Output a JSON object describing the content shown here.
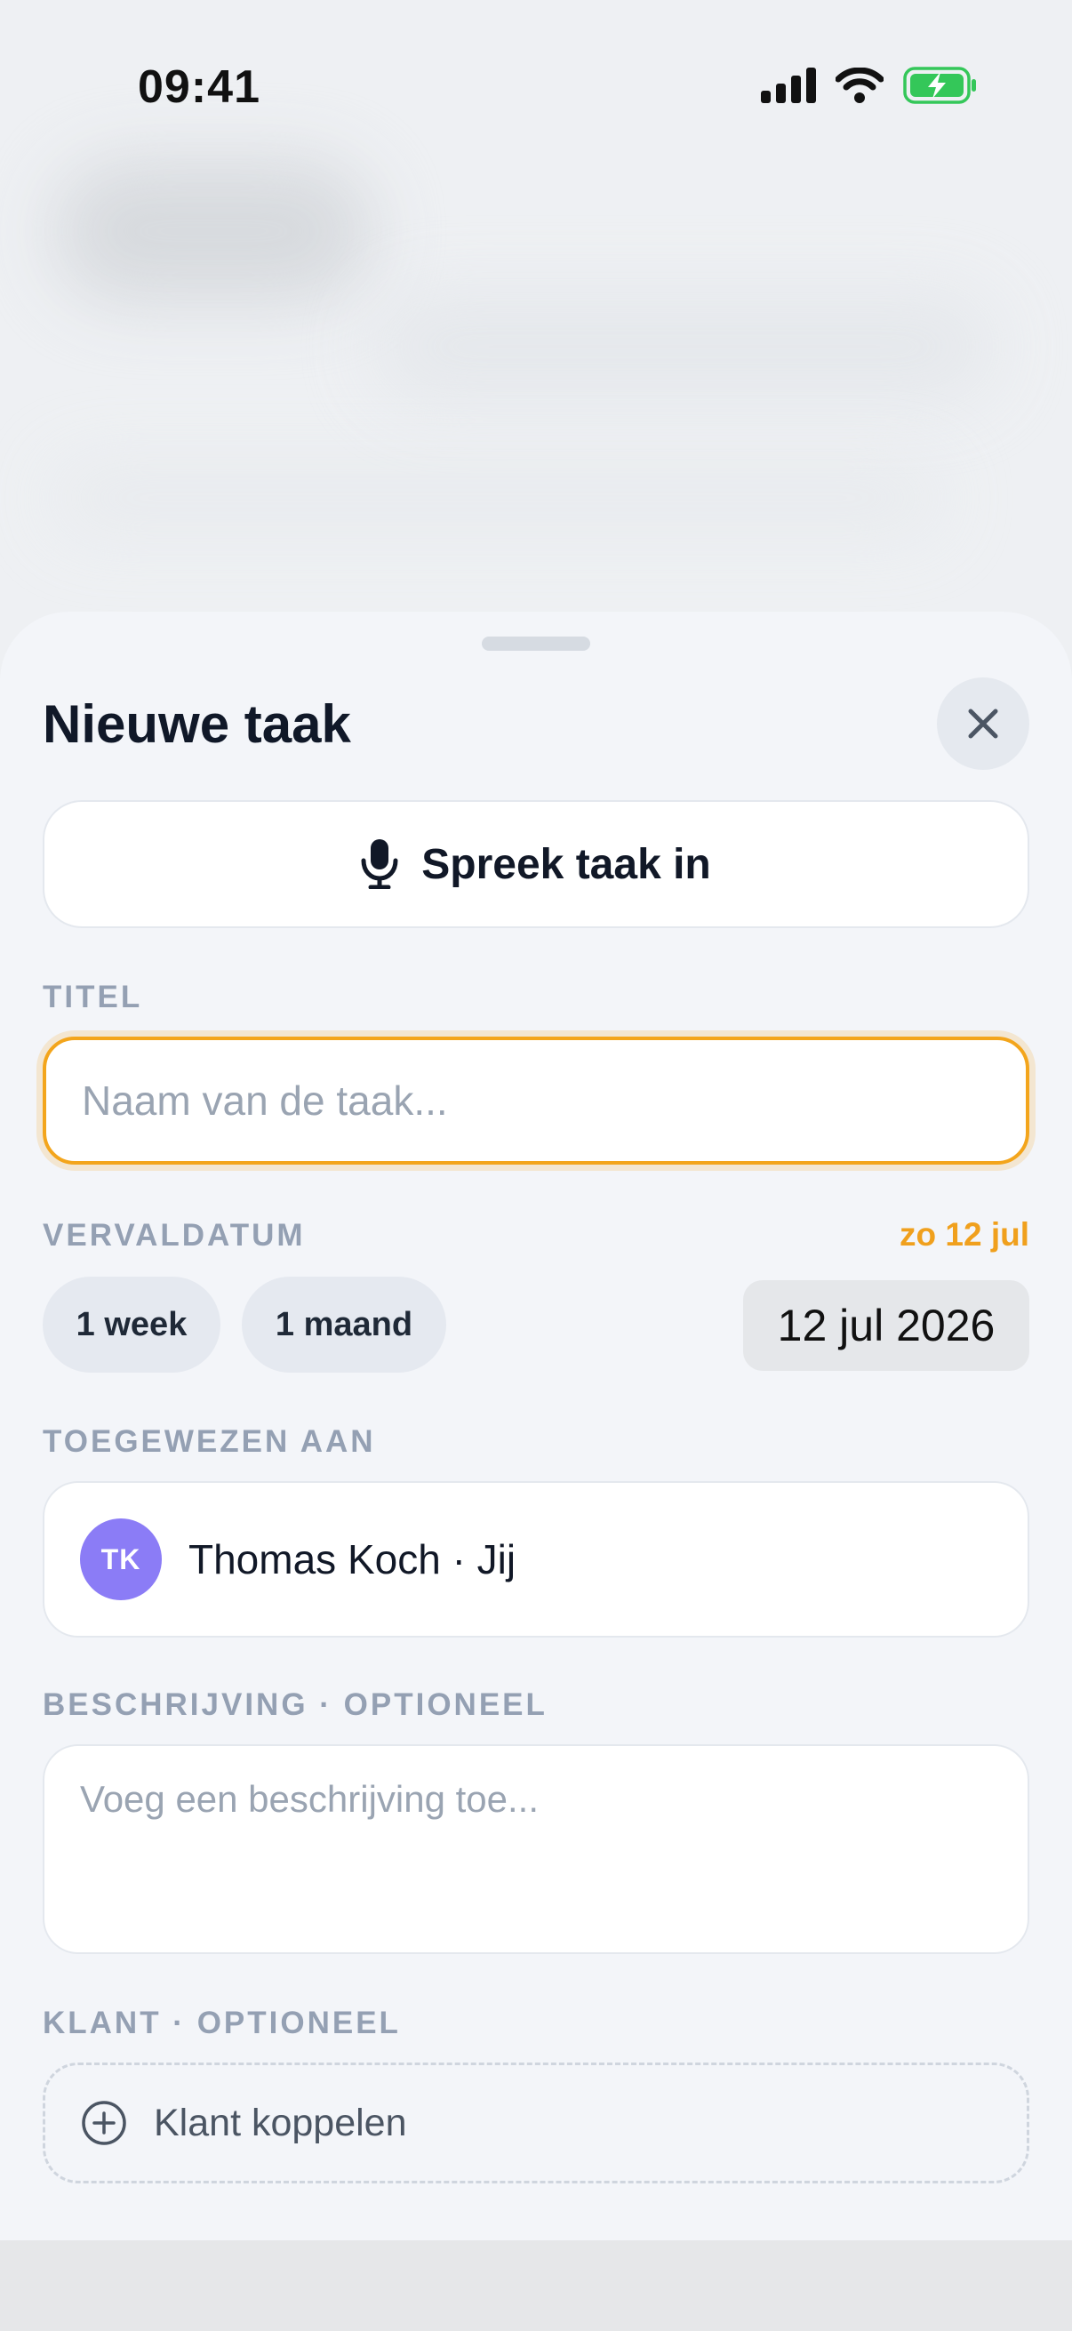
{
  "status_bar": {
    "time": "09:41"
  },
  "sheet": {
    "title": "Nieuwe taak",
    "voice_button_label": "Spreek taak in",
    "title_section": {
      "label": "TITEL",
      "value": "",
      "placeholder": "Naam van de taak..."
    },
    "due_section": {
      "label": "VERVALDATUM",
      "summary": "zo 12 jul",
      "presets": [
        "1 week",
        "1 maand"
      ],
      "date_value": "12 jul 2026"
    },
    "assignee_section": {
      "label": "TOEGEWEZEN AAN",
      "initials": "TK",
      "name": "Thomas Koch · Jij"
    },
    "description_section": {
      "label": "BESCHRIJVING · OPTIONEEL",
      "value": "",
      "placeholder": "Voeg een beschrijving toe..."
    },
    "client_section": {
      "label": "KLANT · OPTIONEEL",
      "button_label": "Klant koppelen"
    }
  },
  "colors": {
    "accent": "#f3a51c",
    "avatar": "#8b7cf6",
    "battery": "#34c759"
  },
  "icons": [
    "cellular-signal-icon",
    "wifi-icon",
    "battery-charging-icon",
    "close-icon",
    "microphone-icon",
    "plus-circle-icon"
  ]
}
